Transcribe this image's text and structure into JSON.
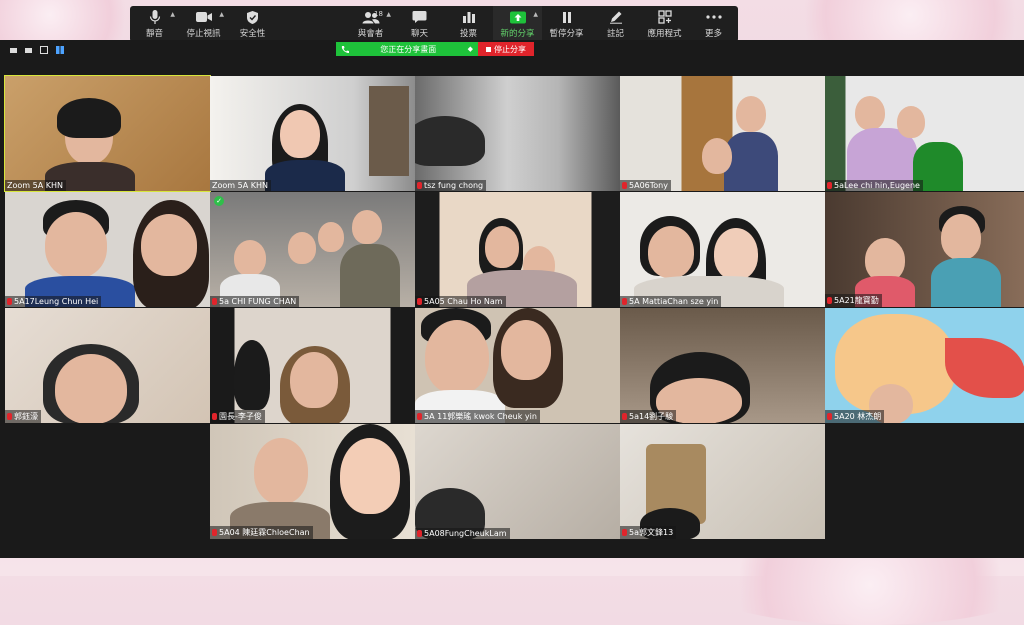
{
  "toolbar": {
    "buttons": [
      {
        "label": "靜音",
        "icon": "microphone-icon",
        "caret": true
      },
      {
        "label": "停止視訊",
        "icon": "video-camera-icon",
        "caret": true
      },
      {
        "label": "安全性",
        "icon": "shield-icon",
        "caret": false
      },
      {
        "label": "與會者",
        "icon": "participants-icon",
        "caret": true,
        "count": "18"
      },
      {
        "label": "聊天",
        "icon": "chat-icon",
        "caret": false
      },
      {
        "label": "投票",
        "icon": "poll-icon",
        "caret": false
      },
      {
        "label": "新的分享",
        "icon": "share-screen-icon",
        "caret": true
      },
      {
        "label": "暫停分享",
        "icon": "pause-icon",
        "caret": false
      },
      {
        "label": "註記",
        "icon": "annotate-pen-icon",
        "caret": false
      },
      {
        "label": "應用程式",
        "icon": "apps-icon",
        "caret": false
      },
      {
        "label": "更多",
        "icon": "more-dots-icon",
        "caret": false
      }
    ]
  },
  "share_banner": {
    "status": "您正在分享畫面",
    "stop_label": "停止分享"
  },
  "participants": [
    {
      "name": "Zoom 5A KHN",
      "muted": false,
      "active": true
    },
    {
      "name": "Zoom 5A KHN",
      "muted": false
    },
    {
      "name": "tsz fung chong",
      "muted": true
    },
    {
      "name": "5A06Tony",
      "muted": true
    },
    {
      "name": "5aLee chi hin,Eugene",
      "muted": true
    },
    {
      "name": "5A17Leung Chun Hei",
      "muted": true
    },
    {
      "name": "5a  CHI FUNG CHAN",
      "muted": true,
      "checked": true
    },
    {
      "name": "5A05 Chau Ho Nam",
      "muted": true
    },
    {
      "name": "5A MattiaChan sze yin",
      "muted": true
    },
    {
      "name": "5A21龍寶勤",
      "muted": true
    },
    {
      "name": "郭鈺濠",
      "muted": true
    },
    {
      "name": "園長-李子俊",
      "muted": true
    },
    {
      "name": "5A 11郭樂瑤 kwok Cheuk yin",
      "muted": true
    },
    {
      "name": "5a14劉子駿",
      "muted": true
    },
    {
      "name": "5A20 林杰朗",
      "muted": true
    },
    {
      "name": "5A04 陳廷霖ChloeChan",
      "muted": true
    },
    {
      "name": "5A08FungCheukLam",
      "muted": true
    },
    {
      "name": "5a郭文鋒13",
      "muted": true
    }
  ],
  "colors": {
    "share_green": "#1ec23a",
    "stop_red": "#e0242b",
    "active_speaker": "#d7e63b",
    "grid_view_blue": "#4da3ff"
  }
}
